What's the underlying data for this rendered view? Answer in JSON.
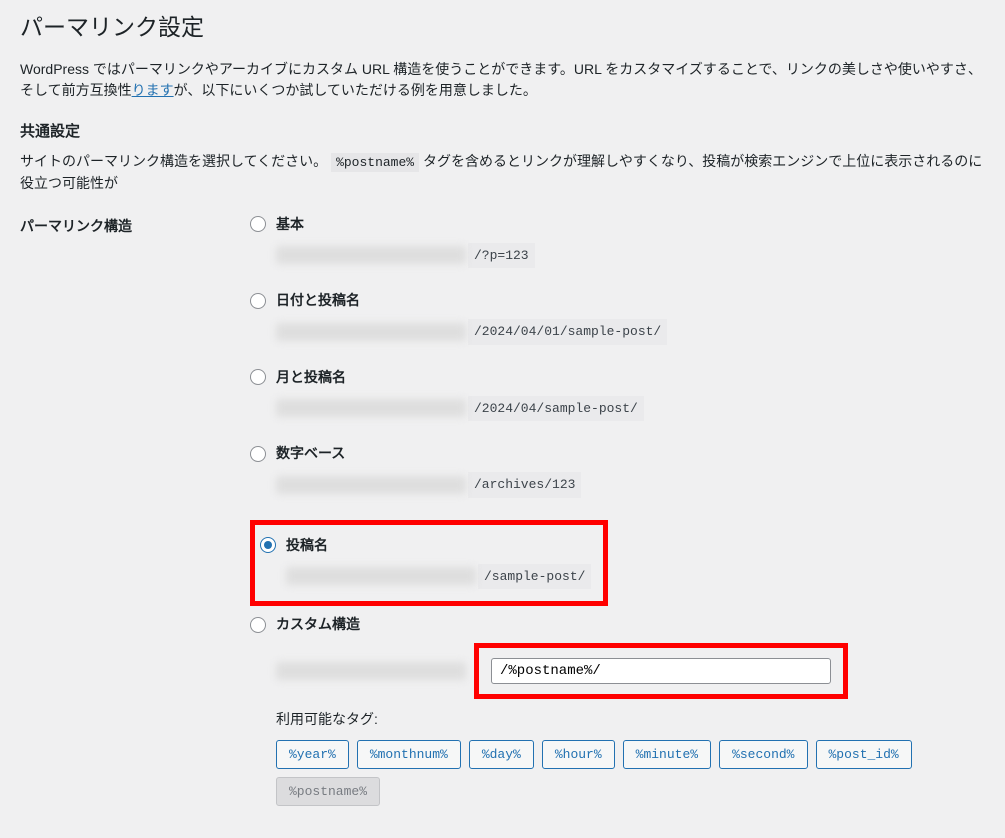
{
  "page": {
    "title": "パーマリンク設定",
    "intro_part1": "WordPress ではパーマリンクやアーカイブにカスタム URL 構造を使うことができます。URL をカスタマイズすることで、リンクの美しさや使いやすさ、そして前方互換性",
    "intro_link": "ります",
    "intro_part2": "が、以下にいくつか試していただける例を用意しました。",
    "common_heading": "共通設定",
    "desc_part1": "サイトのパーマリンク構造を選択してください。",
    "desc_code": "%postname%",
    "desc_part2": " タグを含めるとリンクが理解しやすくなり、投稿が検索エンジンで上位に表示されるのに役立つ可能性が"
  },
  "structureLabel": "パーマリンク構造",
  "options": {
    "plain": {
      "label": "基本",
      "example": "/?p=123"
    },
    "day_name": {
      "label": "日付と投稿名",
      "example": "/2024/04/01/sample-post/"
    },
    "month_name": {
      "label": "月と投稿名",
      "example": "/2024/04/sample-post/"
    },
    "numeric": {
      "label": "数字ベース",
      "example": "/archives/123"
    },
    "post_name": {
      "label": "投稿名",
      "example": "/sample-post/"
    },
    "custom": {
      "label": "カスタム構造",
      "value": "/%postname%/"
    }
  },
  "availableTagsLabel": "利用可能なタグ:",
  "tags": {
    "year": "%year%",
    "monthnum": "%monthnum%",
    "day": "%day%",
    "hour": "%hour%",
    "minute": "%minute%",
    "second": "%second%",
    "post_id": "%post_id%",
    "postname": "%postname%"
  }
}
